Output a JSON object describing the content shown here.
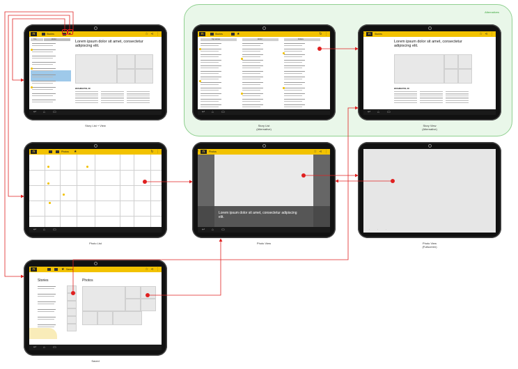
{
  "alternatives_label": "Alternatives",
  "colors": {
    "accent": "#f2c200",
    "link": "#e02020",
    "highlight": "#9ec9ea",
    "alt_region": "#e9f7e9"
  },
  "screens": {
    "story_list_view": {
      "caption": "Story List + View",
      "tab_label": "Stories",
      "column_headers": [
        "Title",
        "World"
      ],
      "list_item_text": "Lorem ipsum dolor sit amet, consectetur adipiscing elit.",
      "article_title": "Lorem ipsum dolor sit amet, consectetur adipiscing elit.",
      "dateline": "WASHINGTON, DC"
    },
    "story_list_alt": {
      "caption_line1": "Story List",
      "caption_line2": "(Alternative)",
      "tab_label": "Stories",
      "column_headers": [
        "Top stories",
        "World",
        "Politics"
      ]
    },
    "story_view_alt": {
      "caption_line1": "Story View",
      "caption_line2": "(Alternative)",
      "back_label": "Stories",
      "article_title": "Lorem ipsum dolor sit amet, consectetur adipiscing elit.",
      "dateline": "WASHINGTON, DC"
    },
    "photo_list": {
      "caption": "Photo List",
      "tab_label": "Photos"
    },
    "photo_view": {
      "caption": "Photo View",
      "back_label": "Photos",
      "overlay_text": "Lorem ipsum dolor sit amet, consectetur adipiscing elit."
    },
    "photo_view_fullscreen": {
      "caption_line1": "Photo View",
      "caption_line2": "(Fullscreen)"
    },
    "saved": {
      "caption": "Saved",
      "tab_label": "Saved",
      "stories_heading": "Stories",
      "photos_heading": "Photos",
      "list_item_text": "Lorem ipsum dolor sit amet, consectetur adipiscing elit."
    }
  },
  "icons": {
    "app_logo": "n-logo-icon",
    "stories_tab": "stories-tab-icon",
    "photos_tab": "photos-tab-icon",
    "saved_tab": "star-icon",
    "actions": [
      "star-icon",
      "share-icon",
      "overflow-menu-icon"
    ],
    "nav": [
      "back-icon",
      "home-icon",
      "recents-icon"
    ]
  }
}
